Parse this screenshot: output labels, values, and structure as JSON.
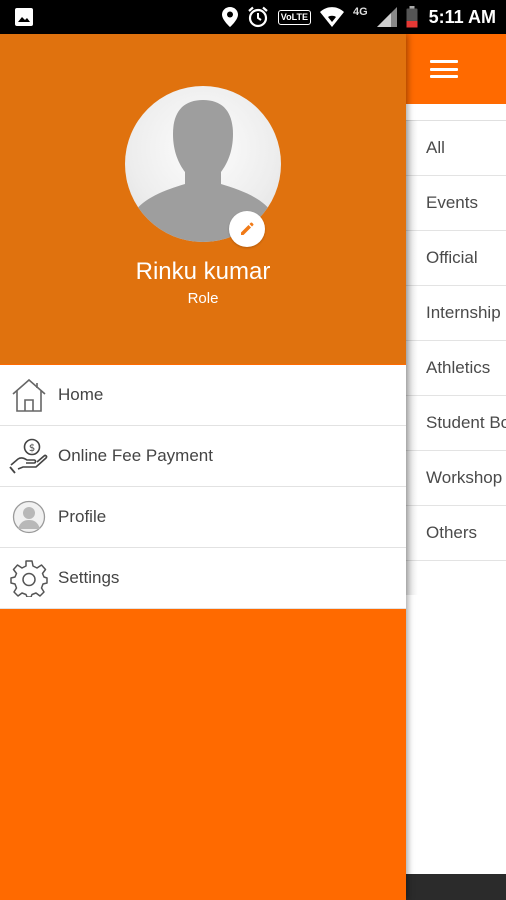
{
  "status_bar": {
    "time": "5:11 AM",
    "volte": "VoLTE",
    "network": "4G",
    "icons": [
      "image-icon",
      "location-icon",
      "alarm-icon",
      "volte-icon",
      "wifi-icon",
      "signal-icon",
      "battery-icon"
    ]
  },
  "colors": {
    "accent": "#ff6a00",
    "header": "#e0720e",
    "edit_icon": "#f07a17"
  },
  "drawer": {
    "user_name": "Rinku kumar",
    "user_role": "Role",
    "menu": [
      {
        "label": "Home",
        "icon": "home-icon"
      },
      {
        "label": "Online Fee Payment",
        "icon": "fee-payment-icon"
      },
      {
        "label": "Profile",
        "icon": "profile-icon"
      },
      {
        "label": "Settings",
        "icon": "gear-icon"
      }
    ]
  },
  "categories": [
    "All",
    "Events",
    "Official",
    "Internship",
    "Athletics",
    "Student Bo",
    "Workshop",
    "Others"
  ]
}
